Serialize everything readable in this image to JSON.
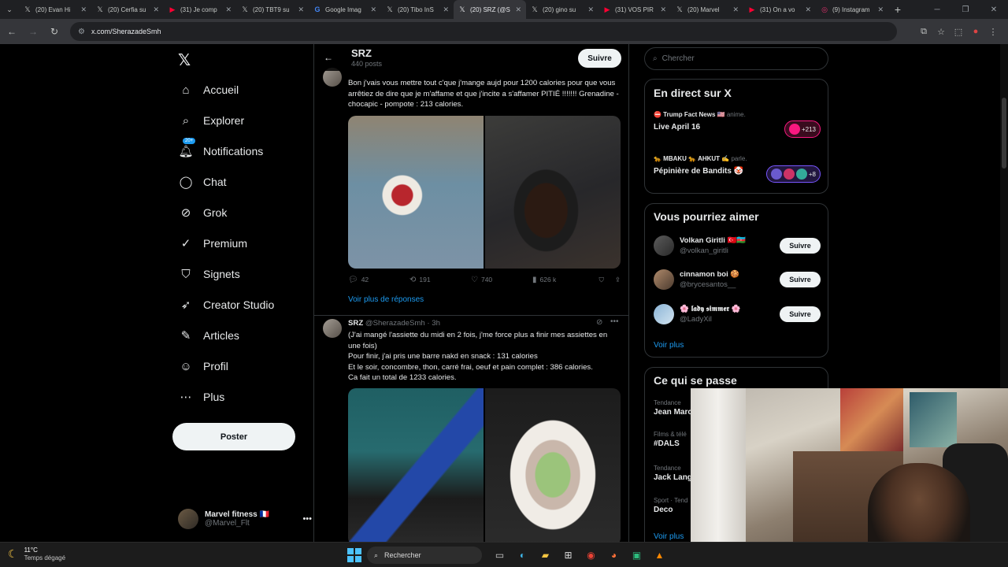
{
  "browser": {
    "tabs": [
      {
        "title": "(20) Evan Hi",
        "icon": "x-icon",
        "active": false
      },
      {
        "title": "(20) Cerfia su",
        "icon": "x-icon",
        "active": false
      },
      {
        "title": "(31) Je comp",
        "icon": "youtube-icon",
        "active": false
      },
      {
        "title": "(20) TBT9 su",
        "icon": "x-icon",
        "active": false
      },
      {
        "title": "Google Imag",
        "icon": "google-icon",
        "active": false
      },
      {
        "title": "(20) Tibo InS",
        "icon": "x-icon",
        "active": false
      },
      {
        "title": "(20) SRZ (@S",
        "icon": "x-icon",
        "active": true
      },
      {
        "title": "(20) gino su",
        "icon": "x-icon",
        "active": false
      },
      {
        "title": "(31) VOS PIR",
        "icon": "youtube-icon",
        "active": false
      },
      {
        "title": "(20) Marvel",
        "icon": "x-icon",
        "active": false
      },
      {
        "title": "(31) On a vo",
        "icon": "youtube-icon",
        "active": false
      },
      {
        "title": "(9) Instagram",
        "icon": "instagram-icon",
        "active": false
      }
    ],
    "url": "x.com/SherazadeSmh"
  },
  "nav": {
    "items": [
      {
        "label": "Accueil",
        "icon": "home-icon"
      },
      {
        "label": "Explorer",
        "icon": "search-icon"
      },
      {
        "label": "Notifications",
        "icon": "bell-icon",
        "badge": "20+"
      },
      {
        "label": "Chat",
        "icon": "chat-icon"
      },
      {
        "label": "Grok",
        "icon": "grok-icon"
      },
      {
        "label": "Premium",
        "icon": "premium-icon"
      },
      {
        "label": "Signets",
        "icon": "bookmark-icon"
      },
      {
        "label": "Creator Studio",
        "icon": "rocket-icon"
      },
      {
        "label": "Articles",
        "icon": "article-icon"
      },
      {
        "label": "Profil",
        "icon": "user-icon"
      },
      {
        "label": "Plus",
        "icon": "more-icon"
      }
    ],
    "post_button": "Poster",
    "account": {
      "name": "Marvel fitness 🇫🇷",
      "handle": "@Marvel_Flt"
    }
  },
  "profile_header": {
    "name": "SRZ",
    "posts": "440 posts",
    "follow": "Suivre"
  },
  "tweets": [
    {
      "text": "Bon j'vais vous mettre tout c'que j'mange aujd pour 1200 calories pour que vous arrêtiez de dire que je m'affame et que j'incite a s'affamer PITIÉ !!!!!!! Grenadine - chocapic - pompote : 213 calories.",
      "replies": "42",
      "reposts": "191",
      "likes": "740",
      "views": "626 k",
      "more_replies": "Voir plus de réponses"
    },
    {
      "name": "SRZ",
      "handle": "@SherazadeSmh",
      "time": "· 3h",
      "text_lines": [
        "(J'ai mangé l'assiette du midi en 2 fois, j'me force plus a finir mes assiettes en une fois)",
        "Pour finir, j'ai pris une barre nakd en snack : 131 calories",
        "Et le soir, concombre, thon, carré frai, oeuf et pain complet : 386 calories.",
        "Ca fait un total de 1233 calories."
      ]
    }
  ],
  "sidebar": {
    "search_placeholder": "Chercher",
    "live": {
      "title": "En direct sur X",
      "items": [
        {
          "host": "⛔ Trump Fact News 🇺🇸",
          "verb": "anime.",
          "title": "Live April 16",
          "count": "+213"
        },
        {
          "host": "🐆 MBAKU 🐆 AHKUT ✍️",
          "verb": "parle.",
          "title": "Pépinière de Bandits 🤡",
          "count": "+8"
        }
      ]
    },
    "who_to_follow": {
      "title": "Vous pourriez aimer",
      "items": [
        {
          "name": "Volkan Giritli 🇹🇷🇦🇿",
          "handle": "@volkan_giritli",
          "follow": "Suivre"
        },
        {
          "name": "cinnamon boi 🍪",
          "handle": "@brycesantos__",
          "follow": "Suivre"
        },
        {
          "name": "🌸 𝖑𝖆𝖉𝖞 𝖘𝖎𝖒𝖒𝖊𝖗 🌸",
          "handle": "@LadyXil",
          "follow": "Suivre"
        }
      ],
      "more": "Voir plus"
    },
    "trends": {
      "title": "Ce qui se passe",
      "items": [
        {
          "context": "Tendance",
          "title": "Jean Marc"
        },
        {
          "context": "Films & télé",
          "title": "#DALS"
        },
        {
          "context": "Tendance",
          "title": "Jack Lang"
        },
        {
          "context": "Sport · Tend",
          "title": "Deco"
        }
      ],
      "more": "Voir plus"
    }
  },
  "taskbar": {
    "temp": "11°C",
    "weather": "Temps dégagé",
    "search": "Rechercher"
  }
}
